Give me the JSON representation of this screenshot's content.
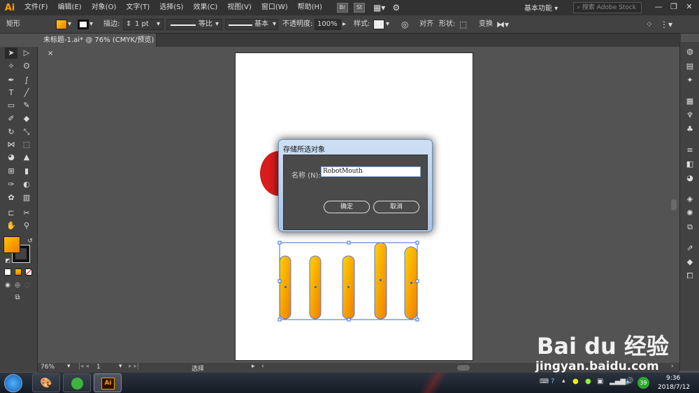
{
  "app": {
    "logo": "Ai"
  },
  "menu": [
    "文件(F)",
    "编辑(E)",
    "对象(O)",
    "文字(T)",
    "选择(S)",
    "效果(C)",
    "视图(V)",
    "窗口(W)",
    "帮助(H)"
  ],
  "menubar_icons": [
    "Br",
    "St"
  ],
  "workspace": "基本功能",
  "stock_search_placeholder": "搜索 Adobe Stock",
  "control": {
    "object_type": "矩形",
    "stroke_label": "描边:",
    "stroke_weight": "1 pt",
    "profile1": "等比",
    "profile2": "基本",
    "opacity_label": "不透明度:",
    "opacity_value": "100%",
    "style_label": "样式:",
    "align_label": "对齐",
    "shape_label": "形状:",
    "transform_label": "变换",
    "fill_color": "#f5a800"
  },
  "document_tab": "未标题-1.ai* @ 76% (CMYK/预览)",
  "status": {
    "zoom": "76%",
    "page": "1",
    "tool": "选择"
  },
  "dialog": {
    "title": "存储所选对象",
    "name_label": "名称 (N):",
    "name_value": "RobotMouth",
    "ok": "确定",
    "cancel": "取消"
  },
  "taskbar": {
    "time": "9:36",
    "date": "2018/7/12",
    "badge": "39",
    "ai_label": "Ai"
  },
  "watermark": {
    "line1": "Bai du 经验",
    "line2": "jingyan.baidu.com"
  },
  "colors": {
    "accent_orange": "#ff9a00",
    "bar_gradient_top": "#ffcc00",
    "bar_gradient_bottom": "#f08c00",
    "circle_red": "#d91c1c",
    "selection_blue": "#3a6fd8"
  }
}
